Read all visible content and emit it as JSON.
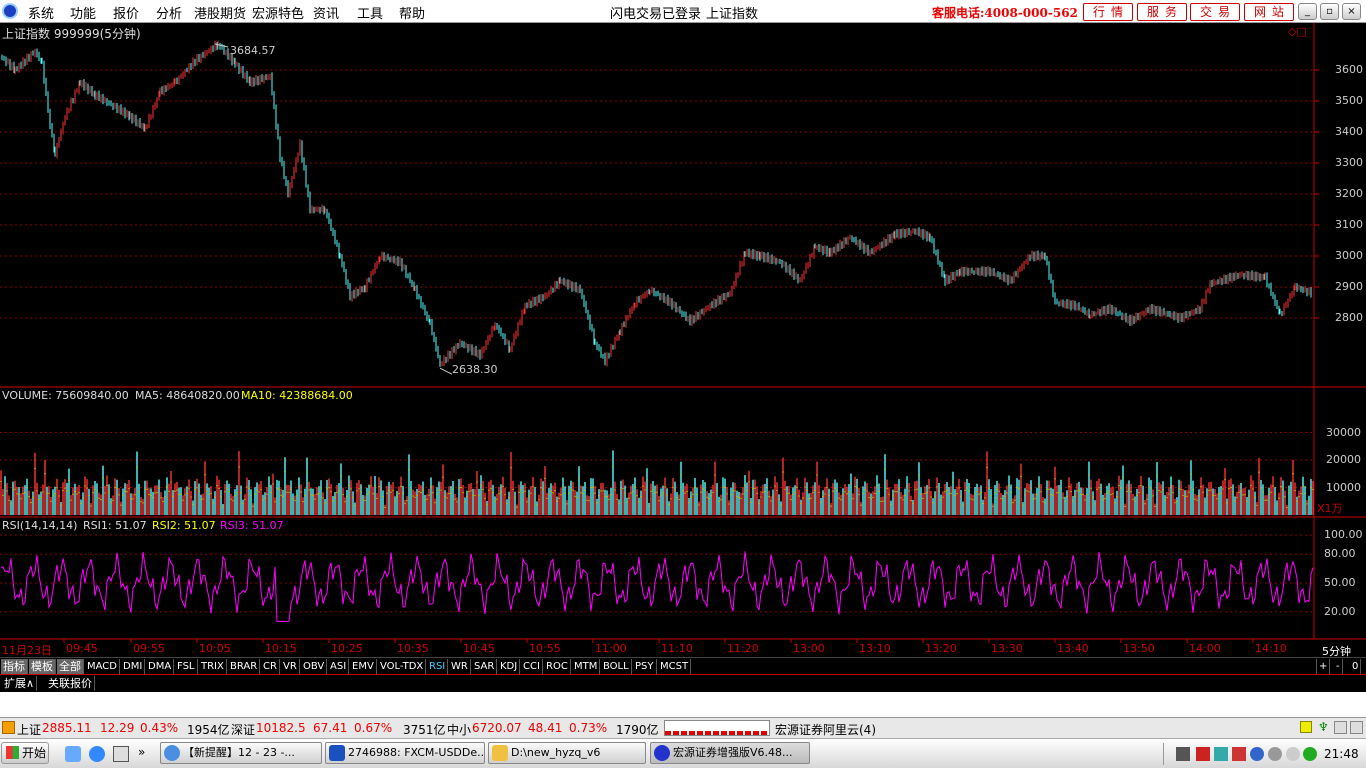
{
  "menubar": {
    "items": [
      "系统",
      "功能",
      "报价",
      "分析",
      "港股期货",
      "宏源特色",
      "资讯",
      "工具",
      "帮助"
    ],
    "status": "闪电交易已登录",
    "current_index": "上证指数",
    "hotline": "客服电话:4008-000-562",
    "right_buttons": [
      "行情",
      "服务",
      "交易",
      "网站"
    ]
  },
  "price_panel": {
    "title": "上证指数  999999(5分钟)",
    "high_label": "3684.57",
    "low_label": "2638.30",
    "y_axis": [
      "3600",
      "3500",
      "3400",
      "3300",
      "3200",
      "3100",
      "3000",
      "2900",
      "2800"
    ]
  },
  "volume_panel": {
    "label_volume": "VOLUME: 75609840.00",
    "label_ma5": "MA5: 48640820.00",
    "label_ma10": "MA10: 42388684.00",
    "y_axis": [
      "30000",
      "20000",
      "10000"
    ],
    "unit": "X1万"
  },
  "rsi_panel": {
    "label_rsi": "RSI(14,14,14)",
    "label_rsi1": "RSI1: 51.07",
    "label_rsi2": "RSI2: 51.07",
    "label_rsi3": "RSI3: 51.07",
    "y_axis": [
      "100.00",
      "80.00",
      "50.00",
      "20.00"
    ]
  },
  "time_axis": {
    "labels": [
      "11月23日",
      "09:45",
      "09:55",
      "10:05",
      "10:15",
      "10:25",
      "10:35",
      "10:45",
      "10:55",
      "11:00",
      "11:10",
      "11:20",
      "13:00",
      "13:10",
      "13:20",
      "13:30",
      "13:40",
      "13:50",
      "14:00",
      "14:10"
    ],
    "period": "5分钟"
  },
  "indicator_tabs": [
    "指标",
    "模板",
    "全部",
    "MACD",
    "DMI",
    "DMA",
    "FSL",
    "TRIX",
    "BRAR",
    "CR",
    "VR",
    "OBV",
    "ASI",
    "EMV",
    "VOL-TDX",
    "RSI",
    "WR",
    "SAR",
    "KDJ",
    "CCI",
    "ROC",
    "MTM",
    "BOLL",
    "PSY",
    "MCST"
  ],
  "tab_controls": [
    "+",
    "-",
    "0"
  ],
  "ext_tabs": [
    "扩展∧",
    "关联报价"
  ],
  "ticker": {
    "sh_name": "上证",
    "sh_value": "2885.11",
    "sh_change": "12.29",
    "sh_pct": "0.43%",
    "sh_amount": "1954亿",
    "sz_name": "深证",
    "sz_value": "10182.5",
    "sz_change": "67.41",
    "sz_pct": "0.67%",
    "sz_amount": "3751亿",
    "zx_name": "中小",
    "zx_value": "6720.07",
    "zx_change": "48.41",
    "zx_pct": "0.73%",
    "zx_amount": "1790亿",
    "server": "宏源证券阿里云(4)"
  },
  "taskbar": {
    "start": "开始",
    "tasks": [
      "【新提醒】12 - 23 -...",
      "2746988: FXCM-USDDe...",
      "D:\\new_hyzq_v6",
      "宏源证券增强版V6.48..."
    ],
    "clock": "21:48"
  },
  "colors": {
    "up": "#ff3232",
    "down": "#54ffff",
    "grid": "#8b0000",
    "ma5": "#ffffff",
    "ma10": "#ffff00",
    "rsi": "#ff00ff"
  }
}
